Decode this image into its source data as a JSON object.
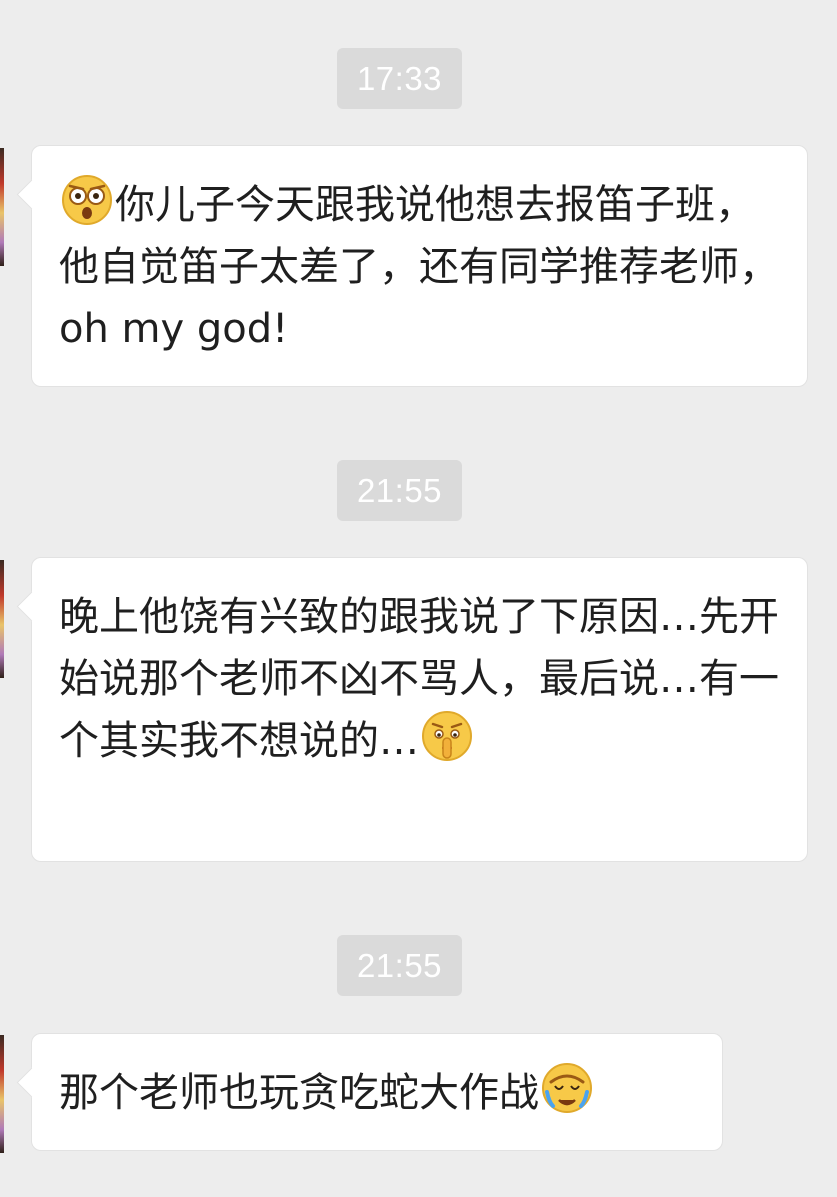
{
  "messages": [
    {
      "time": "17:33",
      "leading_emoji": "shocked-face-icon",
      "text": "你儿子今天跟我说他想去报笛子班，他自觉笛子太差了，还有同学推荐老师，oh my god!"
    },
    {
      "time": "21:55",
      "text": "晚上他饶有兴致的跟我说了下原因…先开始说那个老师不凶不骂人，最后说…有一个其实我不想说的…",
      "trailing_emoji": "shush-face-icon"
    },
    {
      "time": "21:55",
      "text": "那个老师也玩贪吃蛇大作战",
      "trailing_emoji": "facepalm-cry-icon"
    }
  ]
}
